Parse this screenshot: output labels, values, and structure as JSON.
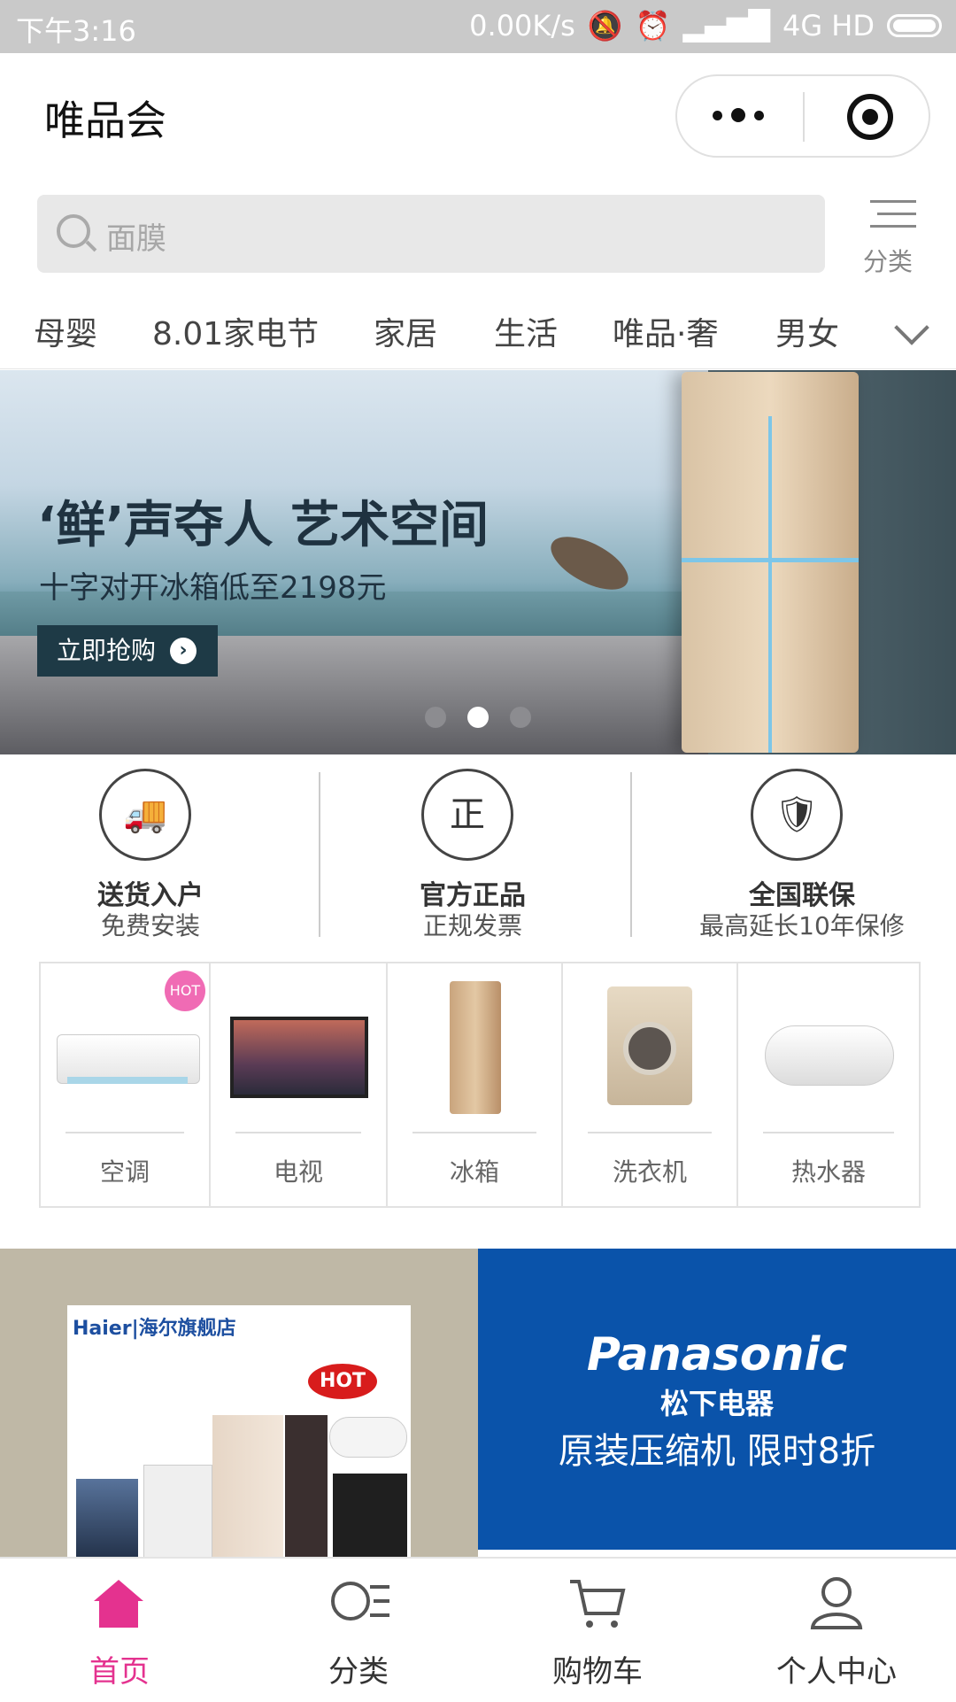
{
  "status_bar": {
    "time": "下午3:16",
    "speed": "0.00K/s",
    "network": "4G HD"
  },
  "app": {
    "title": "唯品会"
  },
  "search": {
    "placeholder": "面膜",
    "category_label": "分类"
  },
  "tabs": [
    "母婴",
    "8.01家电节",
    "家居",
    "生活",
    "唯品·奢",
    "男女"
  ],
  "banner": {
    "headline": "‘鲜’声夺人 艺术空间",
    "subline": "十字对开冰箱低至2198元",
    "cta": "立即抢购",
    "active_dot": 2,
    "dot_count": 3
  },
  "guarantees": [
    {
      "title": "送货入户",
      "subtitle": "免费安装",
      "icon": "truck-icon"
    },
    {
      "title": "官方正品",
      "subtitle": "正规发票",
      "icon": "certified-badge-icon",
      "glyph": "正"
    },
    {
      "title": "全国联保",
      "subtitle": "最高延长10年保修",
      "icon": "shield-icon"
    }
  ],
  "categories": [
    {
      "label": "空调",
      "badge": "HOT"
    },
    {
      "label": "电视"
    },
    {
      "label": "冰箱"
    },
    {
      "label": "洗衣机"
    },
    {
      "label": "热水器"
    }
  ],
  "promos": {
    "left": {
      "logo": "Haier|海尔旗舰店",
      "badge": "HOT"
    },
    "right": {
      "brand": "Panasonic",
      "brand_cn": "松下电器",
      "offer": "原装压缩机 限时8折"
    }
  },
  "bottom_nav": [
    {
      "label": "首页",
      "icon": "home-icon",
      "active": true
    },
    {
      "label": "分类",
      "icon": "category-search-icon"
    },
    {
      "label": "购物车",
      "icon": "cart-icon"
    },
    {
      "label": "个人中心",
      "icon": "user-icon"
    }
  ],
  "colors": {
    "accent": "#e4328f",
    "banner_button": "#1e3a46",
    "panasonic_blue": "#0a53aa"
  }
}
